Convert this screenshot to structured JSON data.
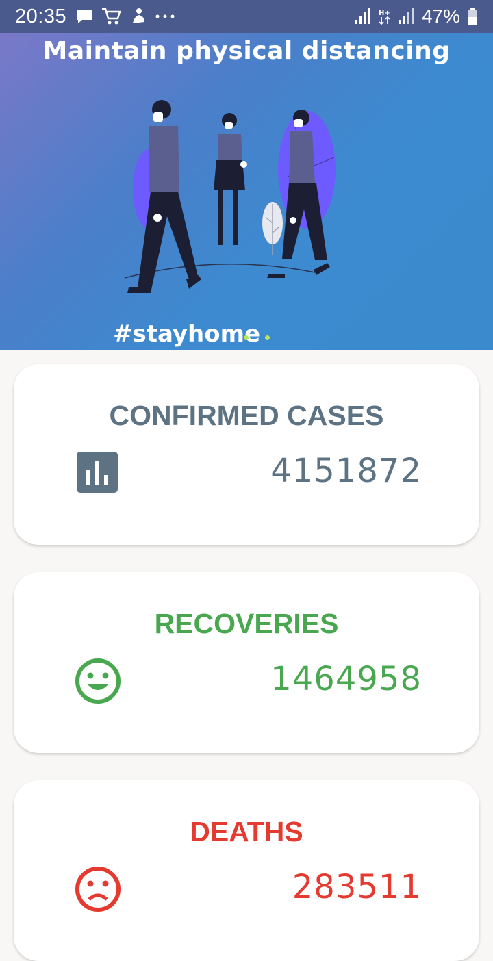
{
  "status_bar": {
    "time": "20:35",
    "battery_percent": "47%",
    "icons_left": [
      "message-icon",
      "shopping-cart-icon",
      "notification-icon",
      "more-icon"
    ],
    "icons_right": [
      "signal-icon",
      "data-icon",
      "signal-icon",
      "battery-icon"
    ]
  },
  "banner": {
    "title": "Maintain physical distancing",
    "hashtag": "#stayhome",
    "page_count": 3,
    "colors": {
      "accent_dot": "#b6e65a"
    }
  },
  "cards": {
    "confirmed": {
      "title": "CONFIRMED CASES",
      "value": "4151872",
      "icon": "bar-chart-icon",
      "color": "#5d7384"
    },
    "recoveries": {
      "title": "RECOVERIES",
      "value": "1464958",
      "icon": "smiley-icon",
      "color": "#48a74f"
    },
    "deaths": {
      "title": "DEATHS",
      "value": "283511",
      "icon": "sad-face-icon",
      "color": "#e53a30"
    }
  }
}
